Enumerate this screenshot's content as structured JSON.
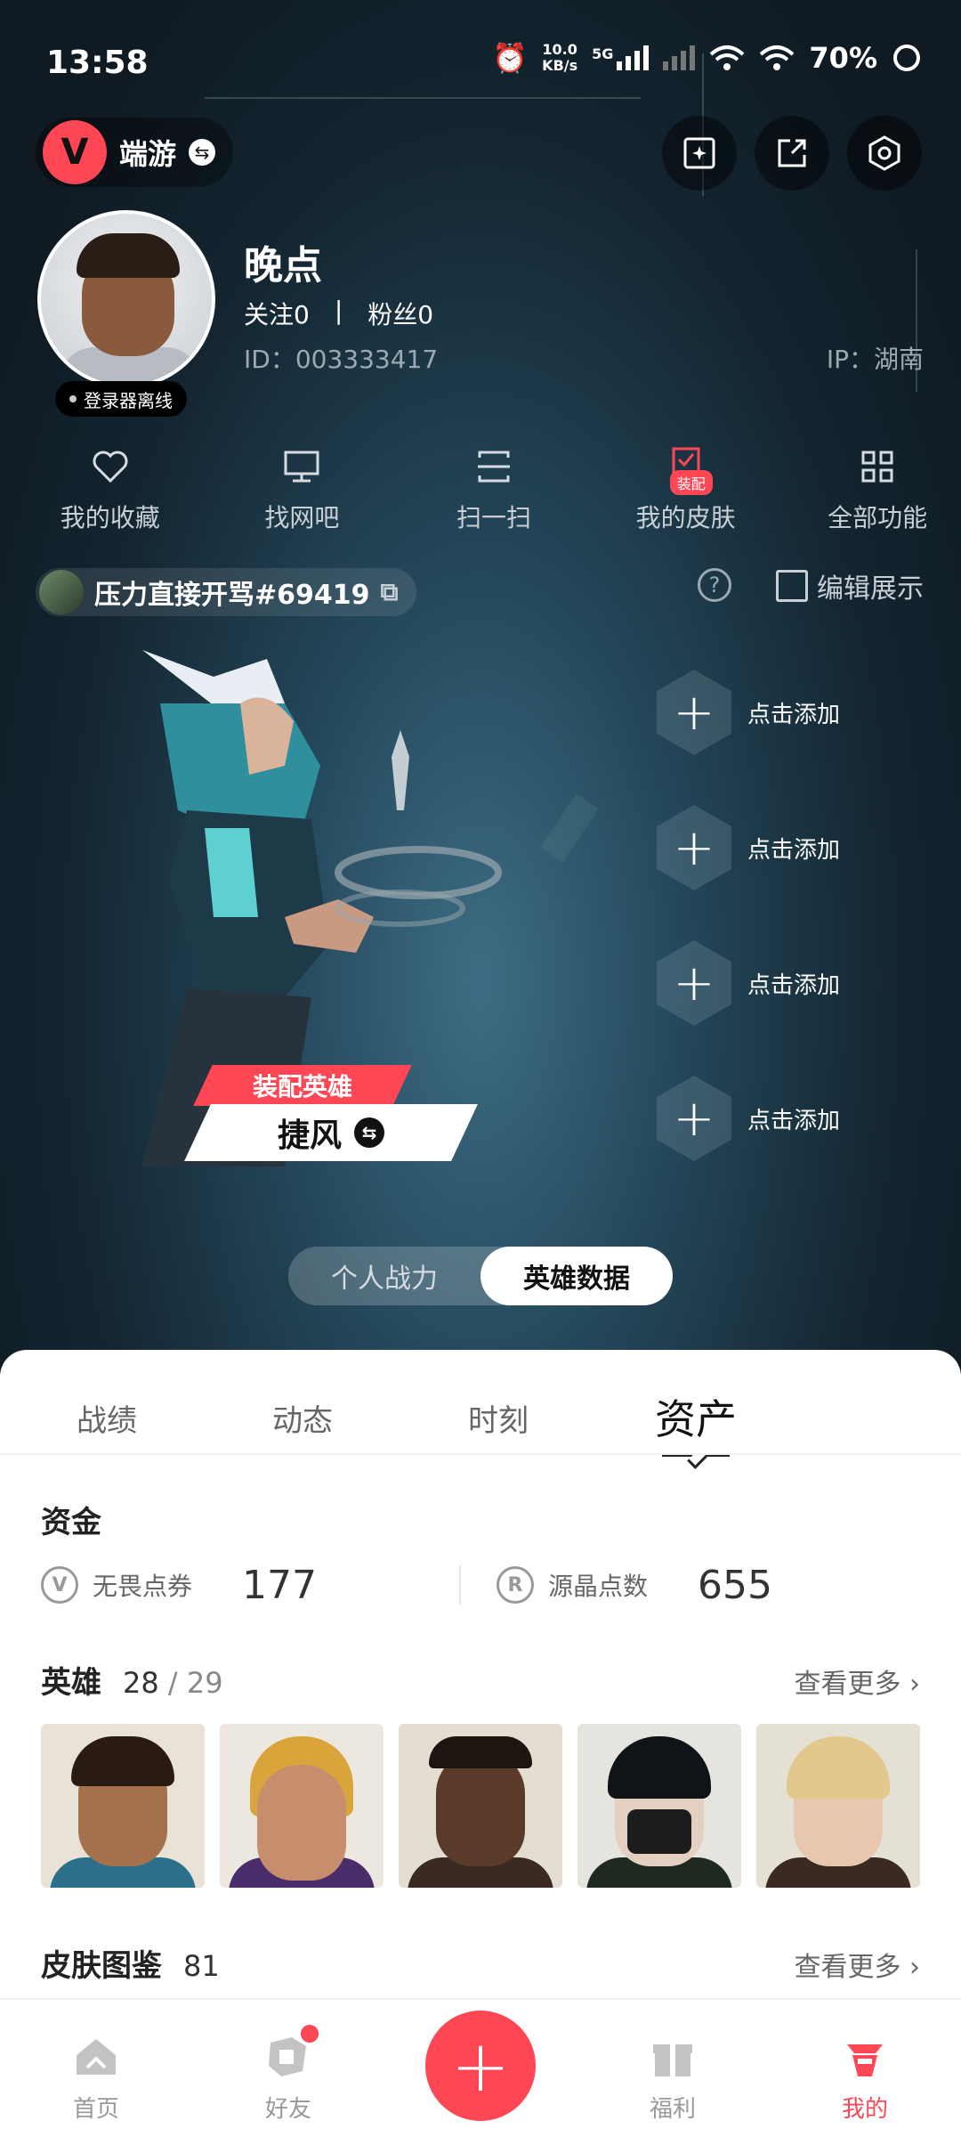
{
  "status_bar": {
    "time": "13:58",
    "net_speed_top": "10.0",
    "net_speed_unit": "KB/s",
    "net_type": "5G",
    "battery": "70%"
  },
  "header": {
    "brand_name": "端游"
  },
  "profile": {
    "name": "晚点",
    "following_label": "关注",
    "following_count": "0",
    "separator": "|",
    "fans_label": "粉丝",
    "fans_count": "0",
    "id_text": "ID：003333417",
    "ip_text": "IP：湖南",
    "launcher_status": "登录器离线"
  },
  "features": [
    {
      "label": "我的收藏",
      "icon": "heart-icon"
    },
    {
      "label": "找网吧",
      "icon": "monitor-icon"
    },
    {
      "label": "扫一扫",
      "icon": "scan-icon"
    },
    {
      "label": "我的皮肤",
      "icon": "skin-icon",
      "badge": "装配"
    },
    {
      "label": "全部功能",
      "icon": "grid-icon"
    }
  ],
  "game_account": {
    "name": "压力直接开骂#69419"
  },
  "edit_label": "编辑展示",
  "agent": {
    "tag": "装配英雄",
    "name": "捷风"
  },
  "slots": [
    {
      "label": "点击添加"
    },
    {
      "label": "点击添加"
    },
    {
      "label": "点击添加"
    },
    {
      "label": "点击添加"
    }
  ],
  "toggle": {
    "left": "个人战力",
    "right": "英雄数据"
  },
  "tabs": [
    "战绩",
    "动态",
    "时刻",
    "资产"
  ],
  "funds": {
    "title": "资金",
    "items": [
      {
        "label": "无畏点券",
        "value": "177",
        "icon": "vp-icon"
      },
      {
        "label": "源晶点数",
        "value": "655",
        "icon": "radianite-icon"
      }
    ]
  },
  "heroes_section": {
    "title": "英雄",
    "owned": "28",
    "slash": "/",
    "total": "29",
    "more": "查看更多"
  },
  "skins_section": {
    "title": "皮肤图鉴",
    "count": "81",
    "more": "查看更多"
  },
  "nav": [
    {
      "label": "首页",
      "icon": "home-icon"
    },
    {
      "label": "好友",
      "icon": "friends-icon"
    },
    {
      "label": "福利",
      "icon": "gift-icon"
    },
    {
      "label": "我的",
      "icon": "me-icon"
    }
  ],
  "colors": {
    "accent": "#ff4655",
    "hero_bg": "#0f1a22",
    "panel_bg": "#ffffff"
  }
}
